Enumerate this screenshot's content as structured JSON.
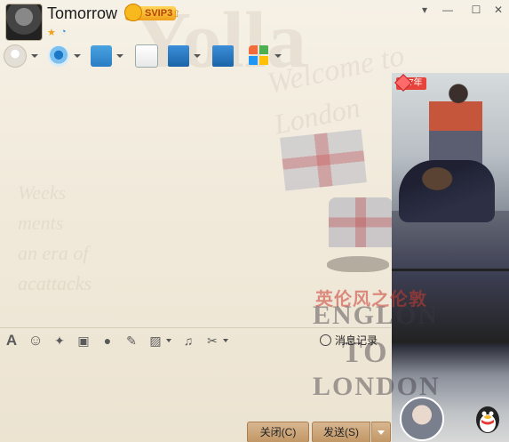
{
  "header": {
    "nickname": "Tomorrow",
    "vip_label": "SVIP3",
    "window_controls": [
      "menu",
      "minimize",
      "maximize",
      "close"
    ]
  },
  "toolbar": {
    "items": [
      {
        "name": "voice-call",
        "icon": "microphone-icon",
        "has_dropdown": true
      },
      {
        "name": "video-call",
        "icon": "camera-icon",
        "has_dropdown": true
      },
      {
        "name": "send-file",
        "icon": "folder-send-icon",
        "has_dropdown": true
      },
      {
        "name": "create-discussion",
        "icon": "chat-add-icon",
        "has_dropdown": false
      },
      {
        "name": "remote-desktop",
        "icon": "remote-desktop-icon",
        "has_dropdown": true
      },
      {
        "name": "share-screen",
        "icon": "screen-share-icon",
        "has_dropdown": false
      },
      {
        "name": "apps",
        "icon": "apps-grid-icon",
        "has_dropdown": true
      }
    ]
  },
  "format_toolbar": {
    "items": [
      {
        "icon": "font-icon",
        "glyph": "A"
      },
      {
        "icon": "emoji-icon",
        "glyph": "☺"
      },
      {
        "icon": "magic-wand-icon",
        "glyph": "✦"
      },
      {
        "icon": "film-icon",
        "glyph": "▣"
      },
      {
        "icon": "microphone-icon",
        "glyph": "🎙"
      },
      {
        "icon": "edit-icon",
        "glyph": "✎"
      },
      {
        "icon": "image-icon",
        "glyph": "▨",
        "has_dropdown": true
      },
      {
        "icon": "music-icon",
        "glyph": "♫"
      },
      {
        "icon": "scissors-icon",
        "glyph": "✂",
        "has_dropdown": true
      }
    ],
    "history_label": "消息记录"
  },
  "background": {
    "welcome_line1": "Welcome to",
    "welcome_line2": "London",
    "chinese_title": "英伦风之伦敦",
    "big_words": [
      "ENGLON",
      "TO",
      "LONDON"
    ]
  },
  "photo_panel": {
    "badge_text": "7年"
  },
  "buttons": {
    "close_label": "关闭(C)",
    "send_label": "发送(S)"
  },
  "colors": {
    "button_bg": "#c9a078",
    "vip_gold": "#f0a01a",
    "badge_red": "#e6433a"
  }
}
